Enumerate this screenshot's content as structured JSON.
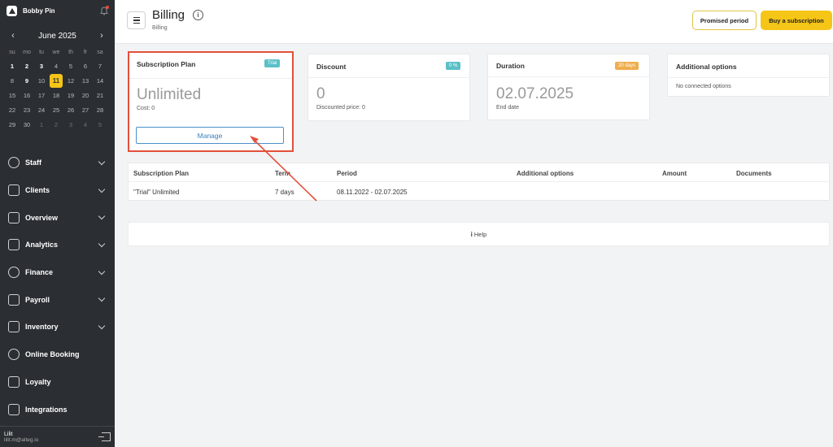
{
  "sidebar": {
    "user_name": "Bobby Pin",
    "calendar": {
      "month_label": "June 2025",
      "weekdays": [
        "su",
        "mo",
        "tu",
        "we",
        "th",
        "fr",
        "sa"
      ],
      "weeks": [
        [
          "1",
          "2",
          "3",
          "4",
          "5",
          "6",
          "7"
        ],
        [
          "8",
          "9",
          "10",
          "11",
          "12",
          "13",
          "14"
        ],
        [
          "15",
          "16",
          "17",
          "18",
          "19",
          "20",
          "21"
        ],
        [
          "22",
          "23",
          "24",
          "25",
          "26",
          "27",
          "28"
        ],
        [
          "29",
          "30",
          "1",
          "2",
          "3",
          "4",
          "5"
        ]
      ],
      "today": "11"
    },
    "menu": [
      {
        "label": "Staff",
        "icon": "person-icon",
        "has_chevron": true
      },
      {
        "label": "Clients",
        "icon": "clients-icon",
        "has_chevron": true
      },
      {
        "label": "Overview",
        "icon": "overview-icon",
        "has_chevron": true
      },
      {
        "label": "Analytics",
        "icon": "analytics-icon",
        "has_chevron": true
      },
      {
        "label": "Finance",
        "icon": "dollar-icon",
        "has_chevron": true
      },
      {
        "label": "Payroll",
        "icon": "payroll-icon",
        "has_chevron": true
      },
      {
        "label": "Inventory",
        "icon": "inventory-icon",
        "has_chevron": true
      },
      {
        "label": "Online Booking",
        "icon": "globe-icon",
        "has_chevron": false
      },
      {
        "label": "Loyalty",
        "icon": "percent-icon",
        "has_chevron": false
      },
      {
        "label": "Integrations",
        "icon": "integrations-icon",
        "has_chevron": false
      }
    ],
    "footer": {
      "name": "Lilit",
      "email": "lilit.m@alteg.io"
    }
  },
  "header": {
    "title": "Billing",
    "breadcrumb": "Billing",
    "promised_label": "Promised period",
    "buy_label": "Buy a subscription"
  },
  "cards": {
    "plan": {
      "title": "Subscription Plan",
      "badge": "Trial",
      "value": "Unlimited",
      "sub": "Cost: 0",
      "button": "Manage"
    },
    "discount": {
      "title": "Discount",
      "badge": "0 %",
      "value": "0",
      "sub": "Discounted price: 0"
    },
    "duration": {
      "title": "Duration",
      "badge": "20 days",
      "value": "02.07.2025",
      "sub": "End date"
    },
    "options": {
      "title": "Additional options",
      "sub": "No connected options"
    }
  },
  "table": {
    "headers": [
      "Subscription Plan",
      "Term",
      "Period",
      "Additional options",
      "Amount",
      "Documents"
    ],
    "rows": [
      [
        "\"Trial\" Unlimited",
        "7 days",
        "08.11.2022 - 02.07.2025",
        "",
        "",
        ""
      ]
    ]
  },
  "help_label": "Help",
  "colors": {
    "accent": "#f5c518",
    "sidebar_bg": "#2b2f33",
    "badge_teal": "#5bc0c7",
    "badge_orange": "#f0ad4e",
    "highlight_red": "#e2503b",
    "link_blue": "#3a7fb8"
  }
}
